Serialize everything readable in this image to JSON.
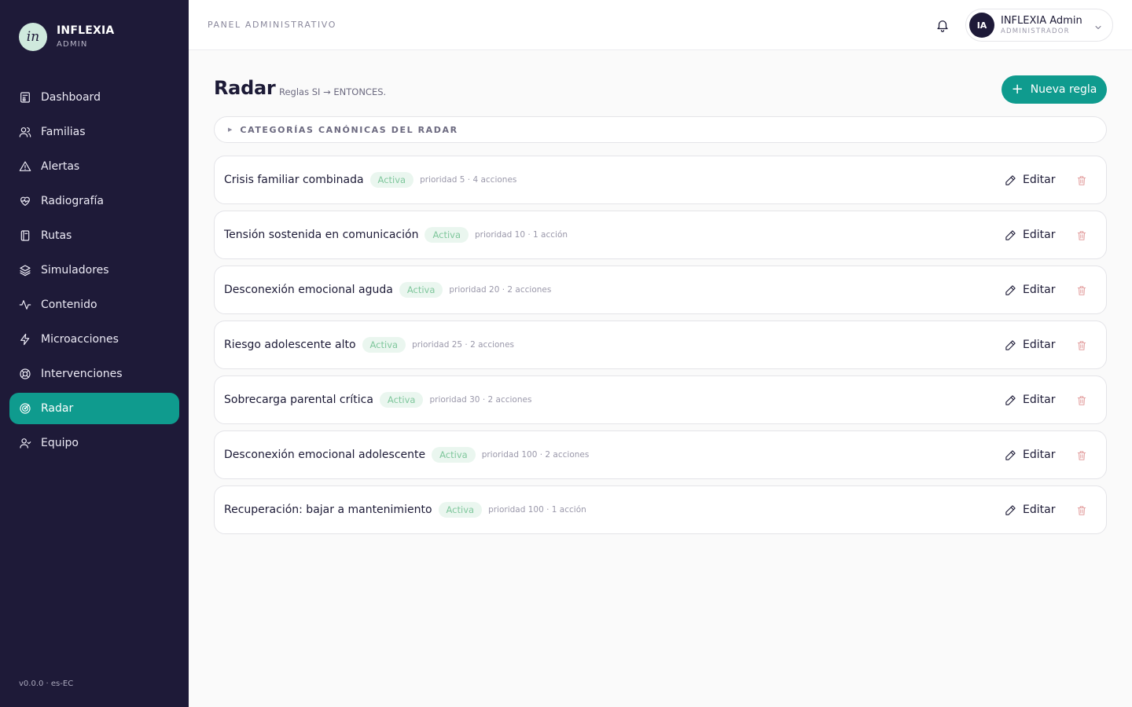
{
  "brand": {
    "logo_text": "in",
    "name": "INFLEXIA",
    "subtitle": "ADMIN"
  },
  "sidebar": {
    "items": [
      {
        "label": "Dashboard",
        "icon": "dashboard-icon"
      },
      {
        "label": "Familias",
        "icon": "users-icon"
      },
      {
        "label": "Alertas",
        "icon": "alert-triangle-icon"
      },
      {
        "label": "Radiografía",
        "icon": "heart-pulse-icon"
      },
      {
        "label": "Rutas",
        "icon": "book-icon"
      },
      {
        "label": "Simuladores",
        "icon": "layers-icon"
      },
      {
        "label": "Contenido",
        "icon": "activity-icon"
      },
      {
        "label": "Microacciones",
        "icon": "zap-icon"
      },
      {
        "label": "Intervenciones",
        "icon": "lifebuoy-icon"
      },
      {
        "label": "Radar",
        "icon": "radar-icon",
        "active": true
      },
      {
        "label": "Equipo",
        "icon": "user-icon"
      }
    ],
    "version": "v0.0.0 · es-EC"
  },
  "header": {
    "title": "PANEL ADMINISTRATIVO",
    "user": {
      "initials": "IA",
      "name": "INFLEXIA Admin",
      "role": "ADMINISTRADOR"
    }
  },
  "main": {
    "title": "Radar",
    "subtitle": "Reglas SI → ENTONCES.",
    "new_button": "Nueva regla",
    "categories_label": "CATEGORÍAS CANÓNICAS DEL RADAR",
    "edit_label": "Editar",
    "rules": [
      {
        "name": "Crisis familiar combinada",
        "status": "Activa",
        "meta": "prioridad 5 · 4 acciones"
      },
      {
        "name": "Tensión sostenida en comunicación",
        "status": "Activa",
        "meta": "prioridad 10 · 1 acción"
      },
      {
        "name": "Desconexión emocional aguda",
        "status": "Activa",
        "meta": "prioridad 20 · 2 acciones"
      },
      {
        "name": "Riesgo adolescente alto",
        "status": "Activa",
        "meta": "prioridad 25 · 2 acciones"
      },
      {
        "name": "Sobrecarga parental crítica",
        "status": "Activa",
        "meta": "prioridad 30 · 2 acciones"
      },
      {
        "name": "Desconexión emocional adolescente",
        "status": "Activa",
        "meta": "prioridad 100 · 2 acciones"
      },
      {
        "name": "Recuperación: bajar a mantenimiento",
        "status": "Activa",
        "meta": "prioridad 100 · 1 acción"
      }
    ]
  },
  "colors": {
    "sidebar_bg": "#1e1a38",
    "accent": "#0f9b8e",
    "badge_bg": "#eaf6ef",
    "badge_text": "#7fc79c",
    "delete": "#e3a0a0"
  }
}
